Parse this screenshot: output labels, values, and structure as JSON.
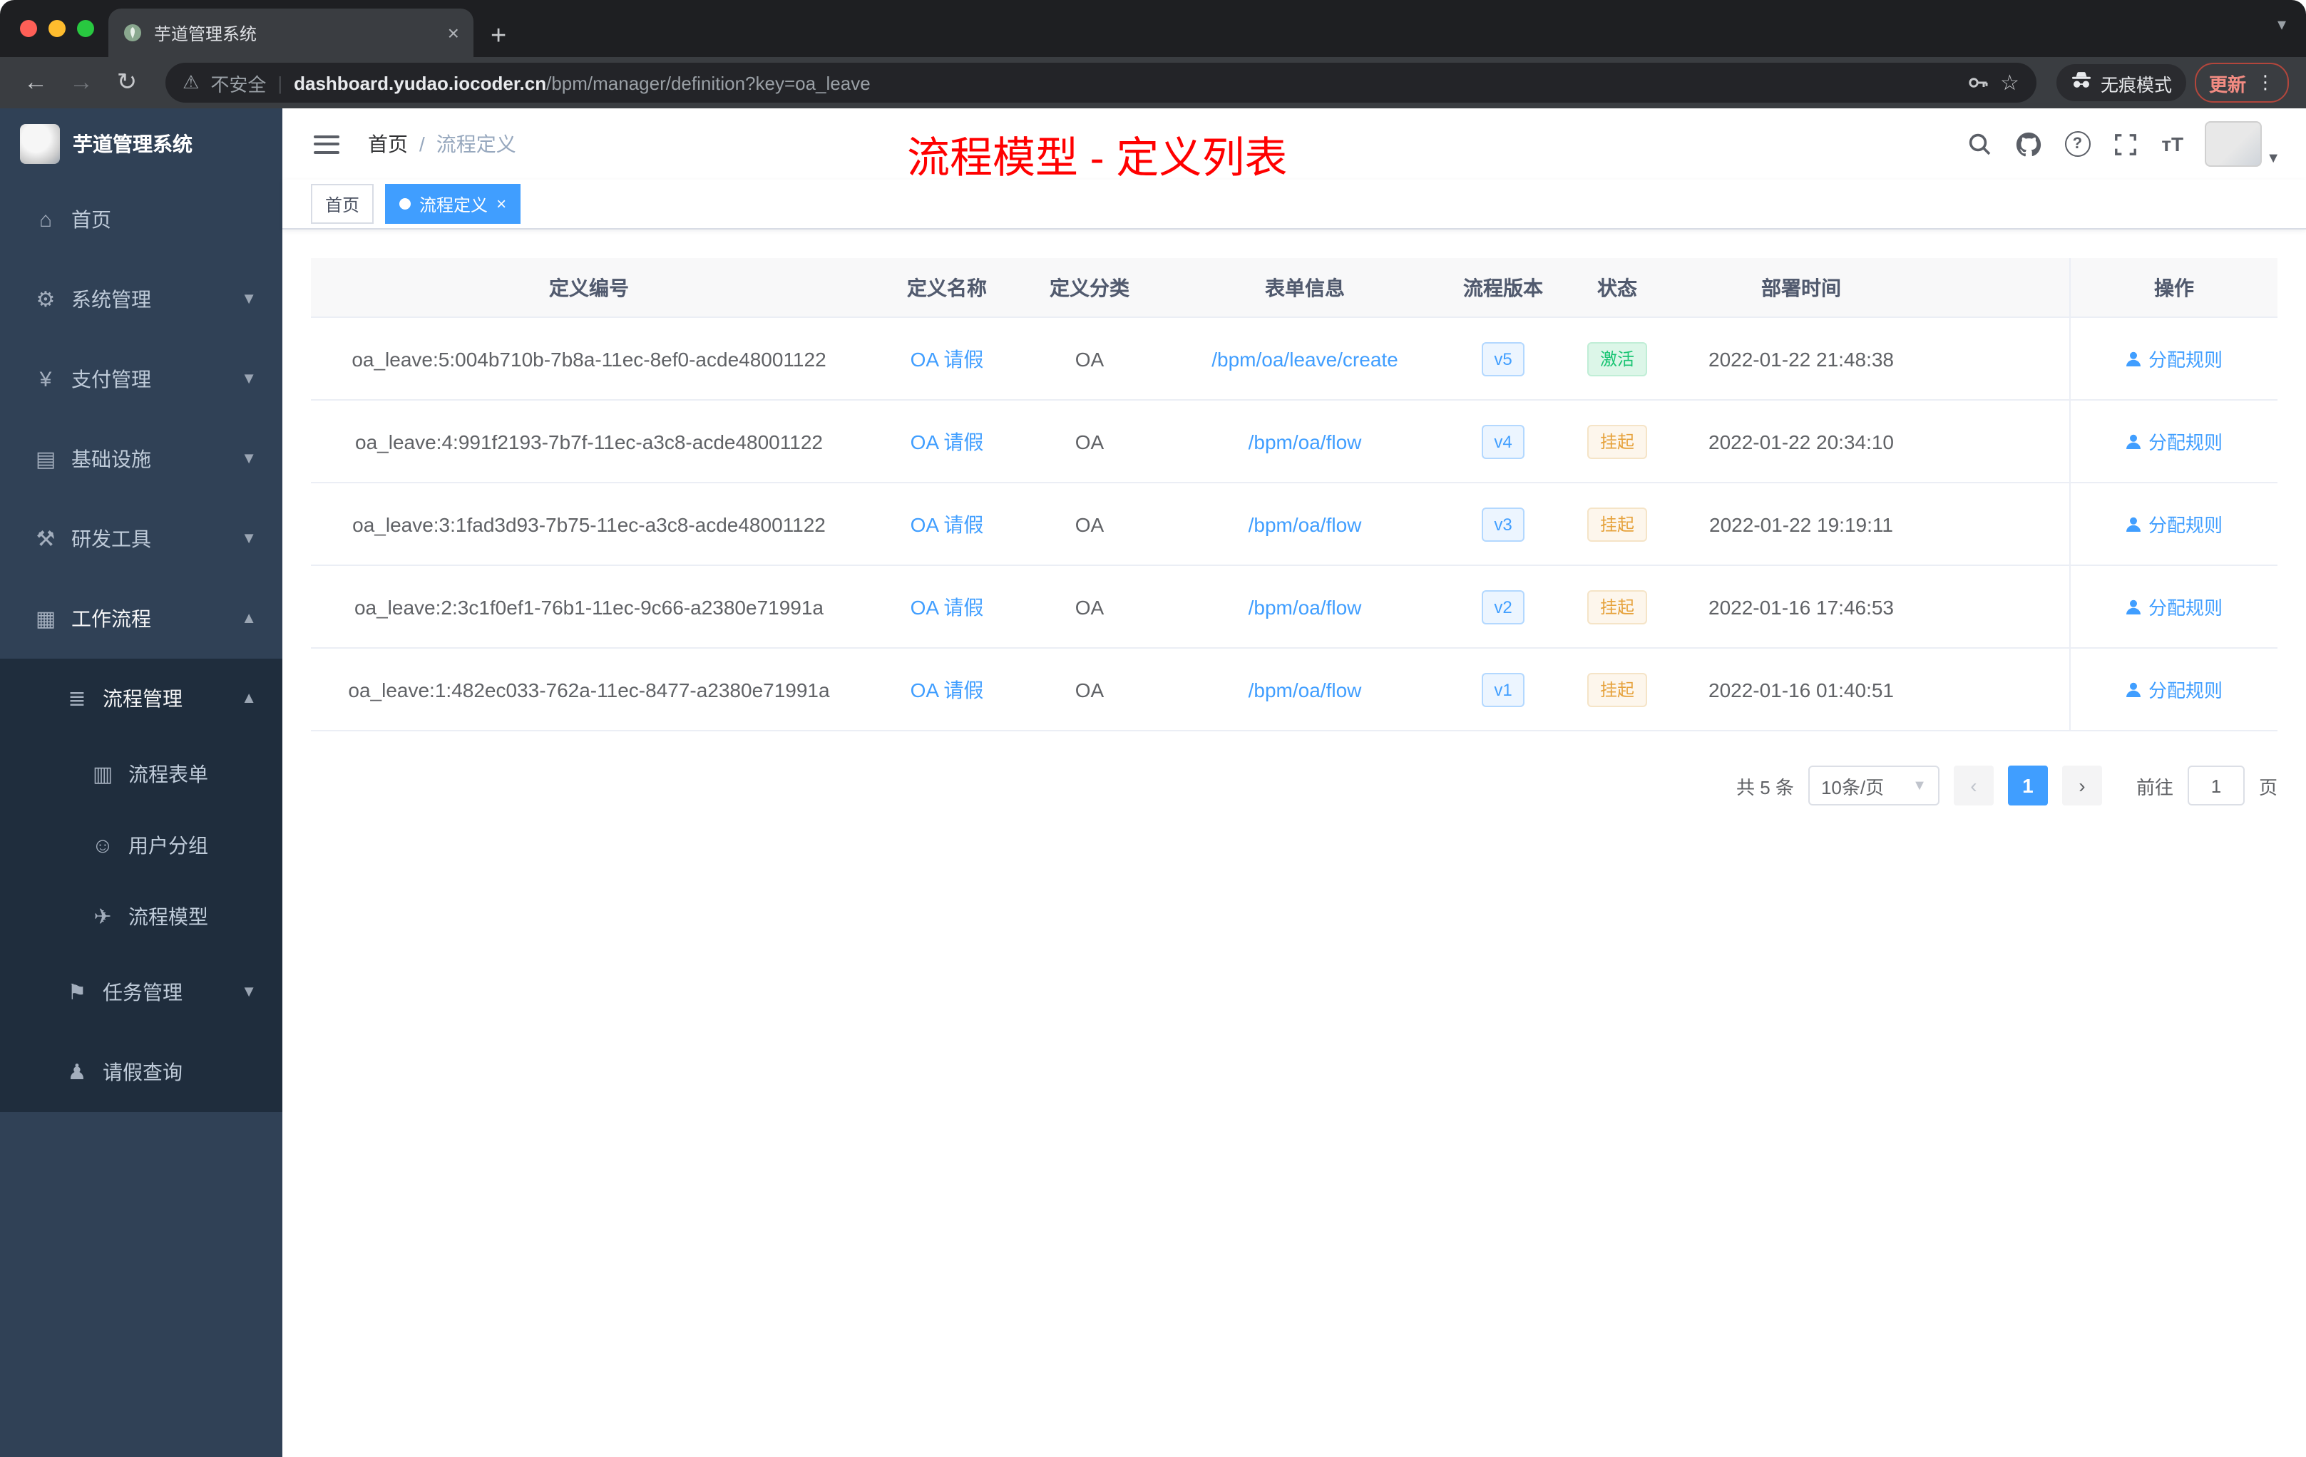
{
  "browser": {
    "tab_title": "芋道管理系统",
    "security_label": "不安全",
    "url_host": "dashboard.yudao.iocoder.cn",
    "url_path": "/bpm/manager/definition?key=oa_leave",
    "incognito_label": "无痕模式",
    "update_label": "更新"
  },
  "sidebar": {
    "title": "芋道管理系统",
    "items": [
      {
        "label": "首页"
      },
      {
        "label": "系统管理"
      },
      {
        "label": "支付管理"
      },
      {
        "label": "基础设施"
      },
      {
        "label": "研发工具"
      },
      {
        "label": "工作流程"
      },
      {
        "label": "流程管理"
      },
      {
        "label": "流程表单"
      },
      {
        "label": "用户分组"
      },
      {
        "label": "流程模型"
      },
      {
        "label": "任务管理"
      },
      {
        "label": "请假查询"
      }
    ]
  },
  "header": {
    "breadcrumb_home": "首页",
    "breadcrumb_sep": "/",
    "breadcrumb_current": "流程定义",
    "annotation": "流程模型 - 定义列表"
  },
  "tags": {
    "home": "首页",
    "active": "流程定义"
  },
  "table": {
    "columns": [
      "定义编号",
      "定义名称",
      "定义分类",
      "表单信息",
      "流程版本",
      "状态",
      "部署时间",
      "操作"
    ],
    "rows": [
      {
        "id": "oa_leave:5:004b710b-7b8a-11ec-8ef0-acde48001122",
        "name": "OA 请假",
        "category": "OA",
        "form": "/bpm/oa/leave/create",
        "version": "v5",
        "status": "激活",
        "deploy_time": "2022-01-22 21:48:38",
        "action": "分配规则"
      },
      {
        "id": "oa_leave:4:991f2193-7b7f-11ec-a3c8-acde48001122",
        "name": "OA 请假",
        "category": "OA",
        "form": "/bpm/oa/flow",
        "version": "v4",
        "status": "挂起",
        "deploy_time": "2022-01-22 20:34:10",
        "action": "分配规则"
      },
      {
        "id": "oa_leave:3:1fad3d93-7b75-11ec-a3c8-acde48001122",
        "name": "OA 请假",
        "category": "OA",
        "form": "/bpm/oa/flow",
        "version": "v3",
        "status": "挂起",
        "deploy_time": "2022-01-22 19:19:11",
        "action": "分配规则"
      },
      {
        "id": "oa_leave:2:3c1f0ef1-76b1-11ec-9c66-a2380e71991a",
        "name": "OA 请假",
        "category": "OA",
        "form": "/bpm/oa/flow",
        "version": "v2",
        "status": "挂起",
        "deploy_time": "2022-01-16 17:46:53",
        "action": "分配规则"
      },
      {
        "id": "oa_leave:1:482ec033-762a-11ec-8477-a2380e71991a",
        "name": "OA 请假",
        "category": "OA",
        "form": "/bpm/oa/flow",
        "version": "v1",
        "status": "挂起",
        "deploy_time": "2022-01-16 01:40:51",
        "action": "分配规则"
      }
    ]
  },
  "pagination": {
    "total": "共 5 条",
    "page_size": "10条/页",
    "current": "1",
    "goto_prefix": "前往",
    "goto_value": "1",
    "goto_suffix": "页"
  },
  "colors": {
    "accent": "#409eff",
    "annotation_red": "#ff0000",
    "status_active": "#18c472",
    "status_suspended": "#e6a23c",
    "sidebar_bg": "#304156",
    "submenu_bg": "#1f2d3d"
  }
}
